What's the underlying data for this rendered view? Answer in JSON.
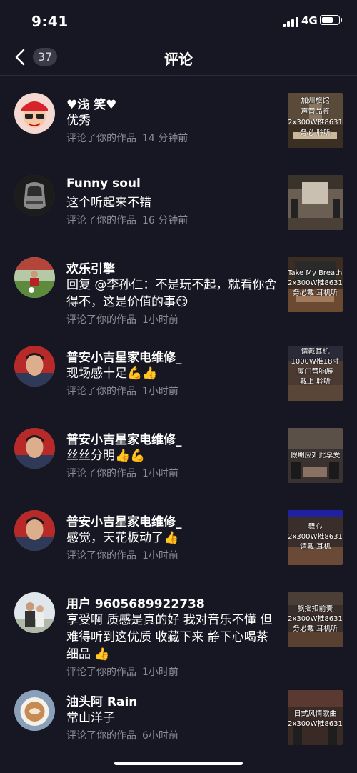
{
  "status": {
    "time": "9:41",
    "network": "4G",
    "battery_level": 0.7
  },
  "nav": {
    "count": "37",
    "title": "评论"
  },
  "comments": [
    {
      "name": "♥浅 笑♥",
      "text": "优秀",
      "meta_action": "评论了你的作品",
      "meta_time": "14 分钟前",
      "thumb": [
        "加州旅馆",
        "声音品鉴",
        "2x300W推8631",
        "务必  聆听"
      ]
    },
    {
      "name": "Funny soul",
      "text": "这个听起来不错",
      "meta_action": "评论了你的作品",
      "meta_time": "16 分钟前",
      "thumb": []
    },
    {
      "name": "欢乐引擎",
      "text": "回复 @李孙仁：不是玩不起，就看你舍得不，这是价值的事😏",
      "meta_action": "评论了你的作品",
      "meta_time": "1小时前",
      "thumb": [
        "Take My Breath Away",
        "2x300W推8631",
        "务必戴 耳机听"
      ]
    },
    {
      "name": "普安小吉星家电维修_",
      "text": "现场感十足💪👍",
      "meta_action": "评论了你的作品",
      "meta_time": "1小时前",
      "thumb": [
        "请戴耳机",
        "1000W推18寸",
        "厦门音响展",
        "戴上 聆听"
      ]
    },
    {
      "name": "普安小吉星家电维修_",
      "text": "丝丝分明👍💪",
      "meta_action": "评论了你的作品",
      "meta_time": "1小时前",
      "thumb": [
        "假期应如此享受"
      ]
    },
    {
      "name": "普安小吉星家电维修_",
      "text": "感觉，天花板动了👍",
      "meta_action": "评论了你的作品",
      "meta_time": "1小时前",
      "thumb": [
        "舞心",
        "2x300W推8631",
        "请戴  耳机"
      ]
    },
    {
      "name": "用户 9605689922738",
      "text": "享受啊 质感是真的好 我对音乐不懂 但难得听到这优质 收藏下来 静下心喝茶细品 👍",
      "meta_action": "评论了你的作品",
      "meta_time": "1小时前",
      "thumb": [
        "飘摇扣前奏",
        "2x300W推8631",
        "务必戴 耳机听"
      ]
    },
    {
      "name": "油头阿 Rain",
      "text": "常山洋子",
      "meta_action": "评论了你的作品",
      "meta_time": "6小时前",
      "thumb": [
        "日式风情歌曲",
        "2x300W推8631"
      ]
    }
  ],
  "icons": {
    "back": "chevron-left-icon",
    "signal": "cellular-signal-icon",
    "battery": "battery-icon"
  }
}
